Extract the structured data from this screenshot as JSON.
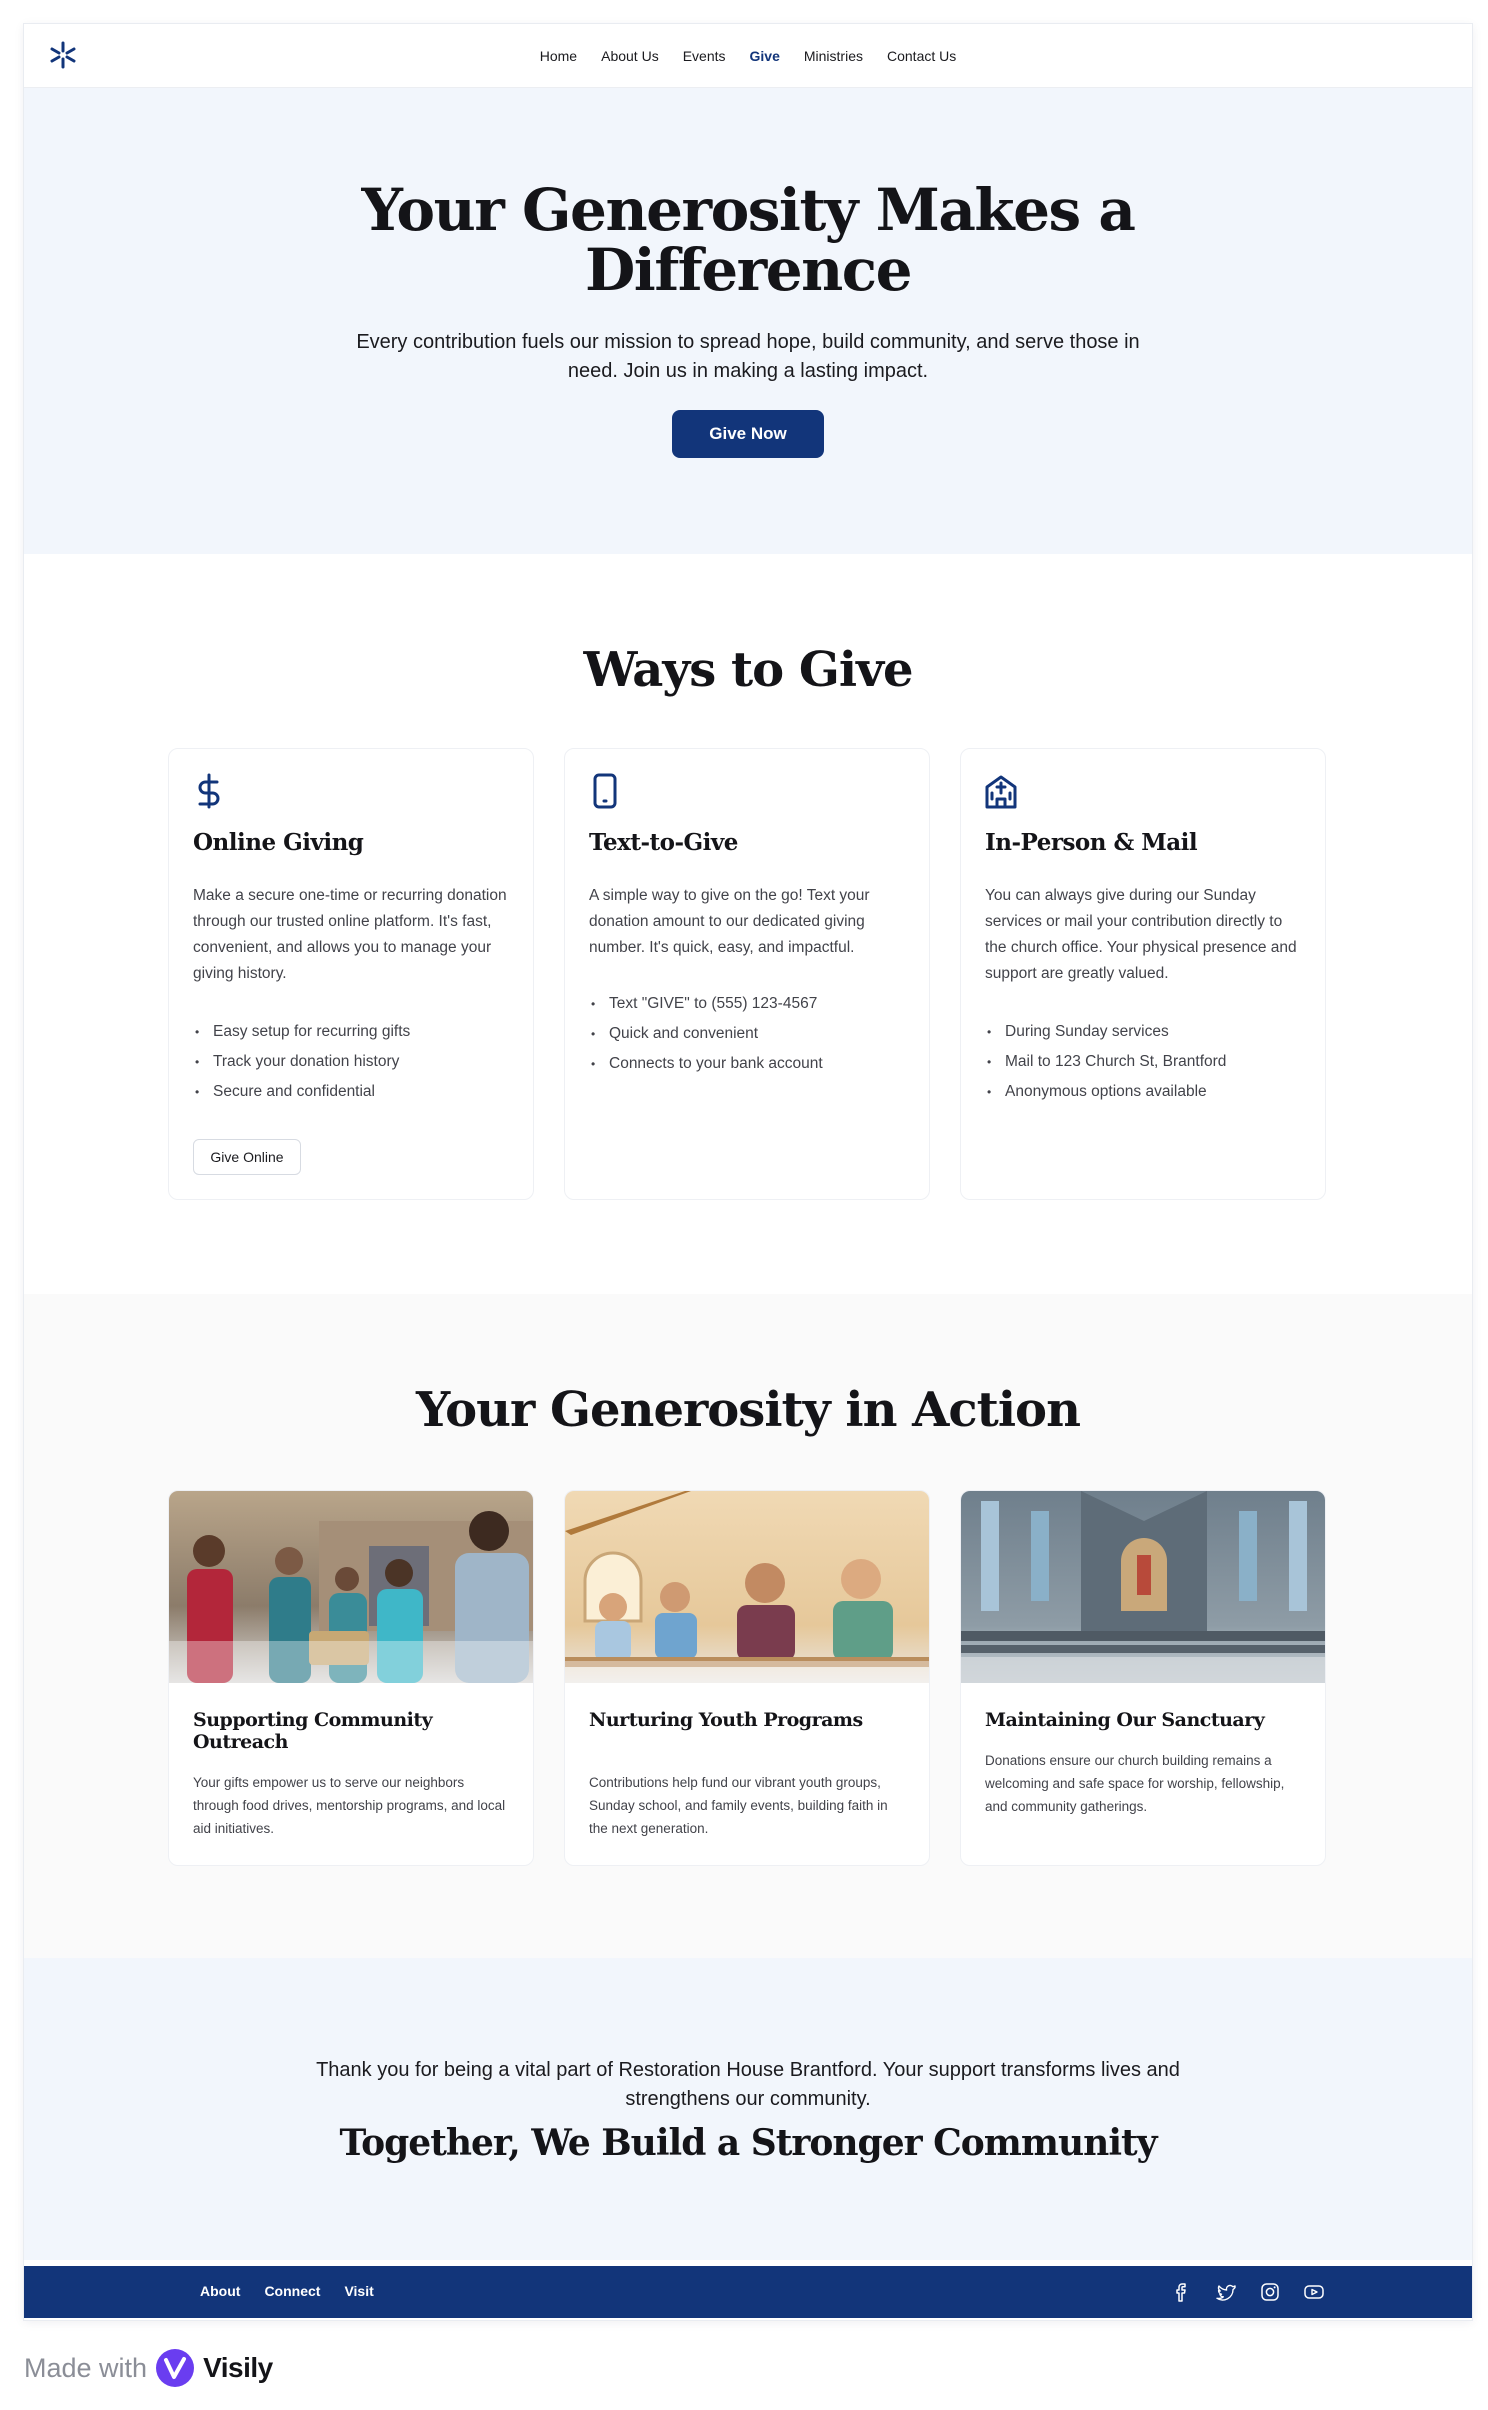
{
  "nav": {
    "logo_icon": "asterisk-logo-icon",
    "links": [
      "Home",
      "About Us",
      "Events",
      "Give",
      "Ministries",
      "Contact Us"
    ],
    "active": "Give"
  },
  "hero": {
    "title": "Your Generosity Makes a Difference",
    "subtitle": "Every contribution fuels our mission to spread hope, build community, and serve those in need. Join us in making a lasting impact.",
    "cta": "Give Now"
  },
  "ways": {
    "title": "Ways to Give",
    "cards": [
      {
        "icon": "dollar-icon",
        "title": "Online Giving",
        "description": "Make a secure one-time or recurring donation through our trusted online platform. It's fast, convenient, and allows you to manage your giving history.",
        "bullets": [
          "Easy setup for recurring gifts",
          "Track your donation history",
          "Secure and confidential"
        ],
        "button": "Give Online"
      },
      {
        "icon": "phone-icon",
        "title": "Text-to-Give",
        "description": "A simple way to give on the go! Text your donation amount to our dedicated giving number. It's quick, easy, and impactful.",
        "bullets": [
          "Text \"GIVE\" to (555) 123-4567",
          "Quick and convenient",
          "Connects to your bank account"
        ]
      },
      {
        "icon": "church-building-icon",
        "title": "In-Person & Mail",
        "description": "You can always give during our Sunday services or mail your contribution directly to the church office. Your physical presence and support are greatly valued.",
        "bullets": [
          "During Sunday services",
          "Mail to 123 Church St, Brantford",
          "Anonymous options available"
        ]
      }
    ]
  },
  "action": {
    "title": "Your Generosity in Action",
    "cards": [
      {
        "image": "community-volunteers-photo",
        "title": "Supporting Community Outreach",
        "text": "Your gifts empower us to serve our neighbors through food drives, mentorship programs, and local aid initiatives."
      },
      {
        "image": "children-classroom-photo",
        "title": "Nurturing Youth Programs",
        "text": "Contributions help fund our vibrant youth groups, Sunday school, and family events, building faith in the next generation."
      },
      {
        "image": "church-sanctuary-photo",
        "title": "Maintaining Our Sanctuary",
        "text": "Donations ensure our church building remains a welcoming and safe space for worship, fellowship, and community gatherings."
      }
    ]
  },
  "thanks": {
    "text": "Thank you for being a vital part of Restoration House Brantford. Your support transforms lives and strengthens our community.",
    "tagline": "Together, We Build a Stronger Community"
  },
  "footer": {
    "links": [
      "About",
      "Connect",
      "Visit"
    ],
    "socials": [
      "facebook-icon",
      "twitter-icon",
      "instagram-icon",
      "youtube-icon"
    ]
  },
  "badge": {
    "prefix": "Made with",
    "brand": "Visily"
  },
  "colors": {
    "primary": "#12357a",
    "hero_bg": "#f2f6fc",
    "section_alt_bg": "#fafafa",
    "text": "#141418",
    "muted_text": "#42434a"
  }
}
